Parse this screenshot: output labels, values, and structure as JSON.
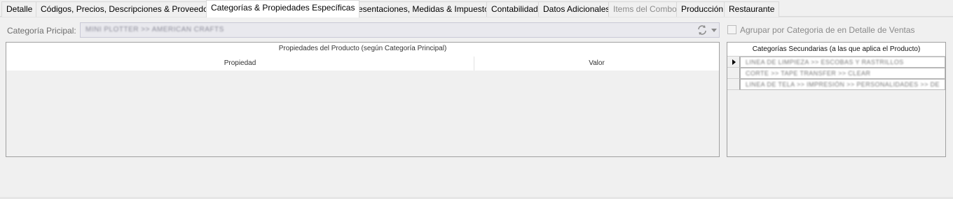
{
  "tabs": [
    {
      "label": "Detalle",
      "active": false,
      "disabled": false
    },
    {
      "label": "Códigos, Precios, Descripciones & Proveedores",
      "active": false,
      "disabled": false
    },
    {
      "label": "Categorías & Propiedades Específicas",
      "active": true,
      "disabled": false
    },
    {
      "label": "Presentaciones, Medidas & Impuestos",
      "active": false,
      "disabled": false
    },
    {
      "label": "Contabilidad",
      "active": false,
      "disabled": false
    },
    {
      "label": "Datos Adicionales",
      "active": false,
      "disabled": false
    },
    {
      "label": "Items del Combo",
      "active": false,
      "disabled": true
    },
    {
      "label": "Producción",
      "active": false,
      "disabled": false
    },
    {
      "label": "Restaurante",
      "active": false,
      "disabled": false
    }
  ],
  "category": {
    "label": "Categoría Pricipal:",
    "value": "MINI PLOTTER >> AMERICAN CRAFTS",
    "refresh_icon": "refresh-icon",
    "dropdown_icon": "chevron-down-icon"
  },
  "group_option": {
    "label": "Agrupar por Categoria de en Detalle de Ventas",
    "checked": false
  },
  "properties_grid": {
    "title": "Propiedades del Producto (según Categoría Principal)",
    "columns": [
      "Propiedad",
      "Valor"
    ]
  },
  "secondary_grid": {
    "title": "Categorías Secundarias (a las que aplica el Producto)",
    "rows": [
      "LINEA DE LIMPIEZA >> ESCOBAS Y RASTRILLOS",
      "CORTE >> TAPE TRANSFER >> CLEAR",
      "LINEA DE TELA >> IMPRESIÓN >> PERSONALIDADES >> DE"
    ],
    "selected_row": 0
  }
}
